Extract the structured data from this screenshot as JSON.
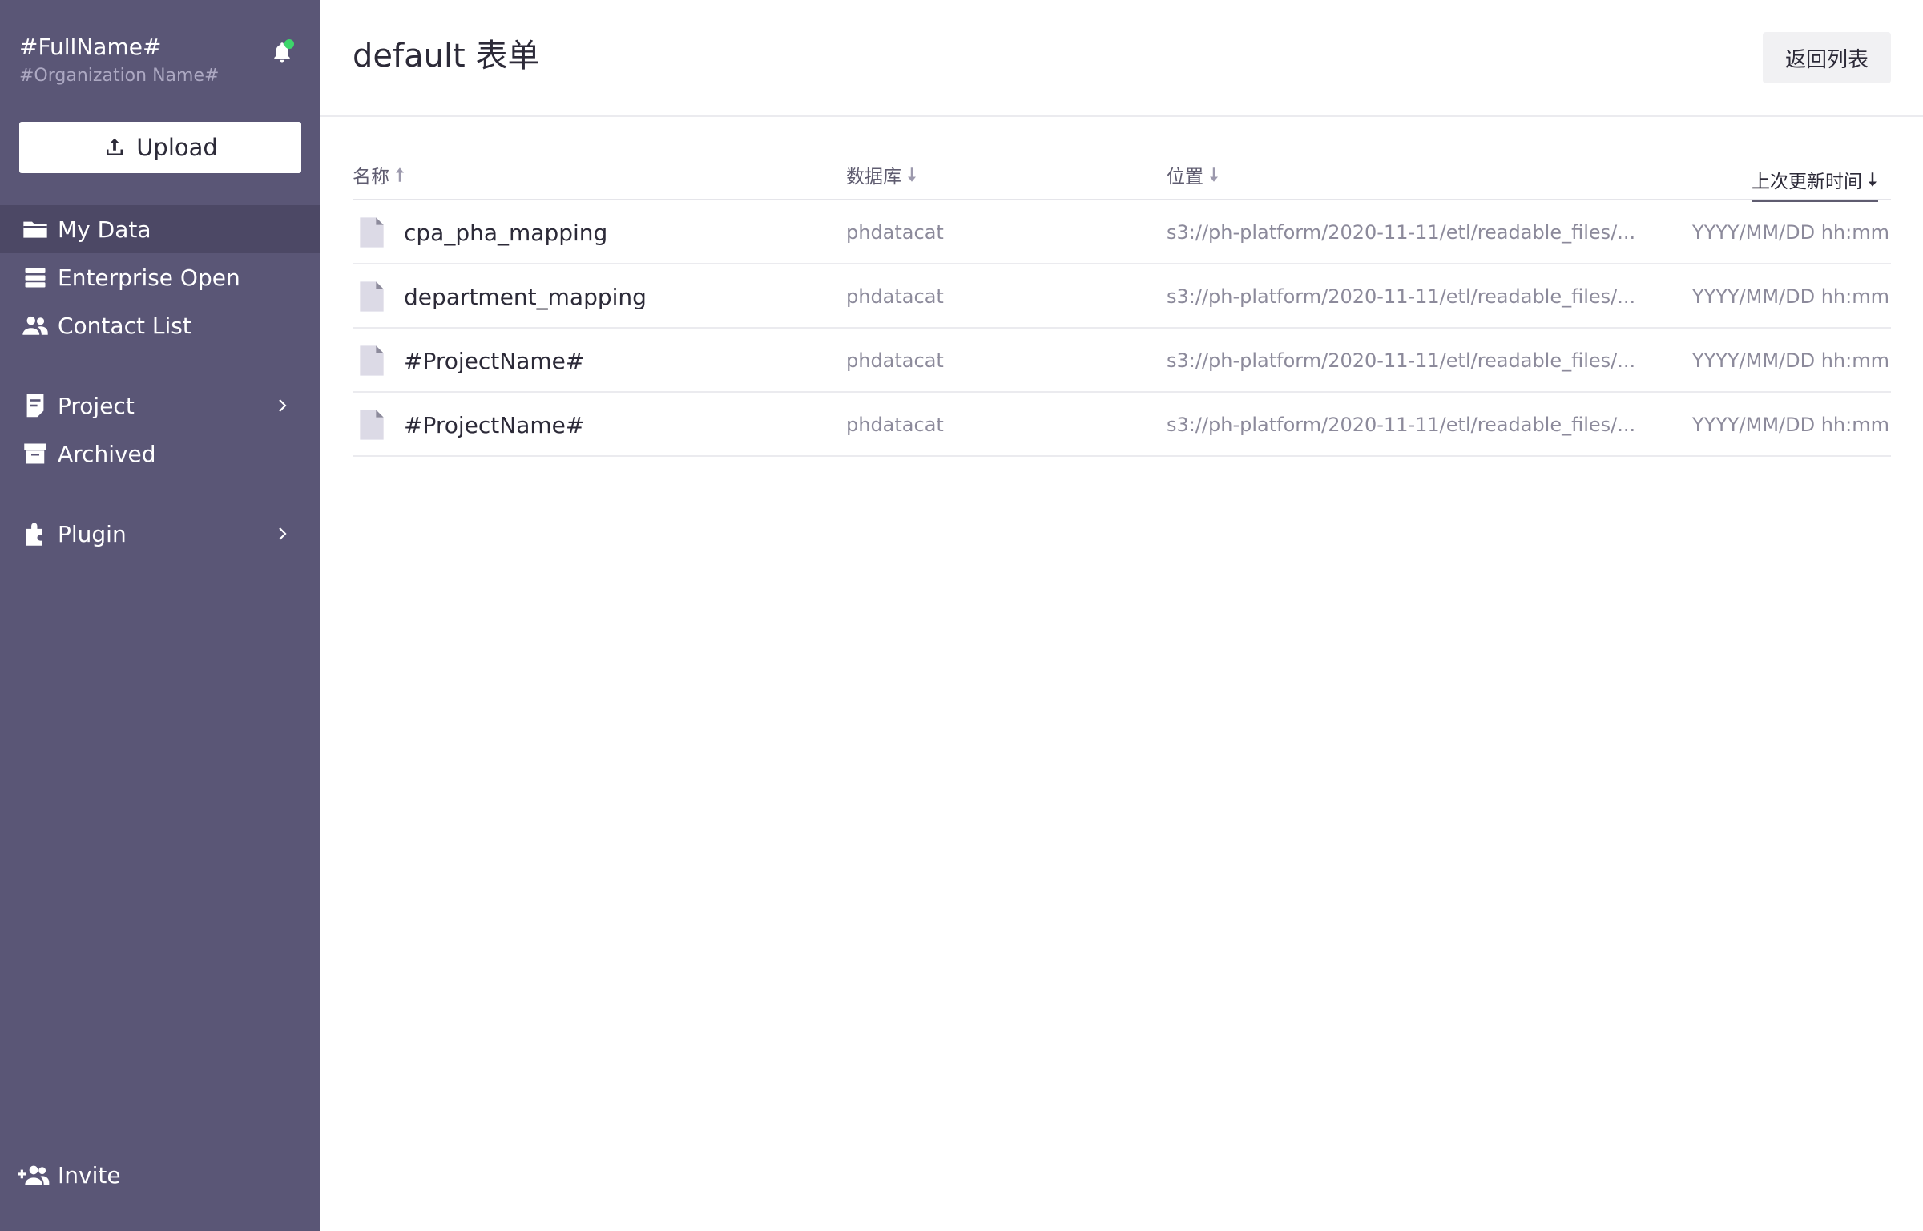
{
  "user": {
    "full_name": "#FullName#",
    "organization": "#Organization Name#"
  },
  "upload_label": "Upload",
  "nav_primary": [
    {
      "label": "My Data",
      "icon": "folder-icon",
      "active": true
    },
    {
      "label": "Enterprise Open",
      "icon": "stack-icon",
      "active": false
    },
    {
      "label": "Contact List",
      "icon": "people-icon",
      "active": false
    }
  ],
  "nav_secondary": [
    {
      "label": "Project",
      "icon": "document-icon",
      "has_submenu": true
    },
    {
      "label": "Archived",
      "icon": "archive-box-icon",
      "has_submenu": false
    }
  ],
  "nav_tertiary": [
    {
      "label": "Plugin",
      "icon": "puzzle-icon",
      "has_submenu": true
    }
  ],
  "invite_label": "Invite",
  "header": {
    "title": "default 表单",
    "back_button": "返回列表"
  },
  "table": {
    "columns": {
      "name": "名称",
      "database": "数据库",
      "location": "位置",
      "updated": "上次更新时间"
    },
    "rows": [
      {
        "name": "cpa_pha_mapping",
        "database": "phdatacat",
        "location": "s3://ph-platform/2020-11-11/etl/readable_files/...",
        "updated": "YYYY/MM/DD hh:mm"
      },
      {
        "name": "department_mapping",
        "database": "phdatacat",
        "location": "s3://ph-platform/2020-11-11/etl/readable_files/...",
        "updated": "YYYY/MM/DD hh:mm"
      },
      {
        "name": "#ProjectName#",
        "database": "phdatacat",
        "location": "s3://ph-platform/2020-11-11/etl/readable_files/...",
        "updated": "YYYY/MM/DD hh:mm"
      },
      {
        "name": "#ProjectName#",
        "database": "phdatacat",
        "location": "s3://ph-platform/2020-11-11/etl/readable_files/...",
        "updated": "YYYY/MM/DD hh:mm"
      }
    ]
  },
  "colors": {
    "sidebar_bg": "#5a5676",
    "sidebar_active": "#4c4865",
    "notification_dot": "#3dd66b",
    "file_icon": "#dcdae6"
  }
}
